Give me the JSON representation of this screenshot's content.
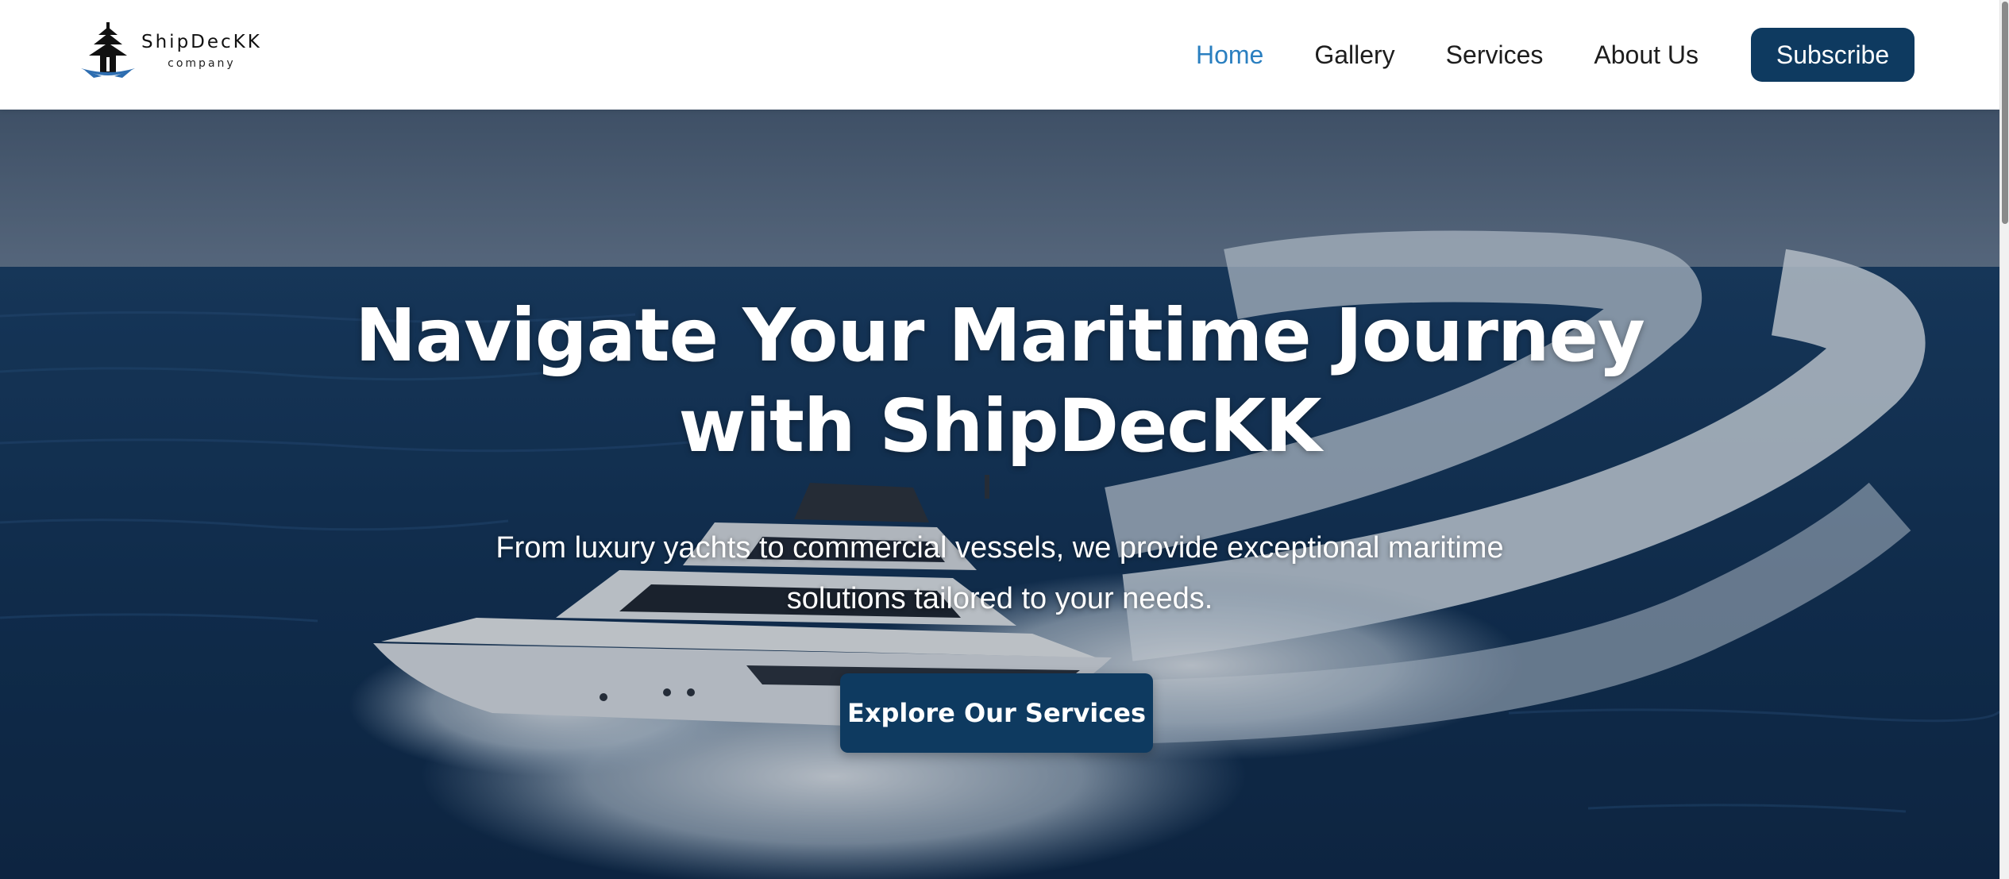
{
  "brand": {
    "name": "ShipDecKK",
    "tagline": "company",
    "logo_icon": "ship-logo-icon"
  },
  "nav": {
    "items": [
      {
        "label": "Home",
        "active": true
      },
      {
        "label": "Gallery",
        "active": false
      },
      {
        "label": "Services",
        "active": false
      },
      {
        "label": "About Us",
        "active": false
      }
    ],
    "subscribe_label": "Subscribe"
  },
  "hero": {
    "title_line1": "Navigate Your Maritime Journey",
    "title_line2": "with ShipDecKK",
    "subtitle_line1": "From luxury yachts to commercial vessels, we provide exceptional maritime",
    "subtitle_line2": "solutions tailored to your needs.",
    "cta_label": "Explore Our Services",
    "background": "yacht-on-ocean-photo"
  },
  "colors": {
    "accent": "#0e3a60",
    "active_link": "#2a7fc0",
    "text_dark": "#1d1d1d"
  }
}
